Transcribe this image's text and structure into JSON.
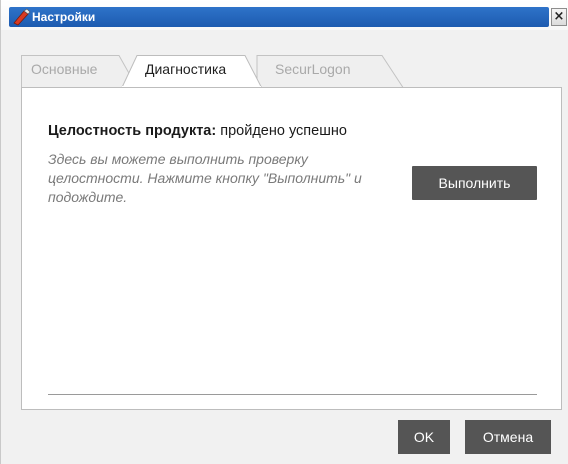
{
  "window": {
    "title": "Настройки",
    "close_glyph": "×"
  },
  "tabs": [
    {
      "label": "Основные",
      "active": false
    },
    {
      "label": "Диагностика",
      "active": true
    },
    {
      "label": "SecurLogon",
      "active": false
    }
  ],
  "diagnostics": {
    "status_label": "Целостность продукта:",
    "status_value": "пройдено успешно",
    "hint": "Здесь вы можете выполнить проверку целостности. Нажмите кнопку \"Выполнить\" и подождите.",
    "run_button": "Выполнить"
  },
  "footer": {
    "ok_label": "OK",
    "cancel_label": "Отмена"
  },
  "colors": {
    "titlebar": "#1d5bb0",
    "button": "#555555",
    "hint_text": "#7a7a7a"
  },
  "icons": {
    "app": "red-tool-icon",
    "close": "close-icon"
  }
}
